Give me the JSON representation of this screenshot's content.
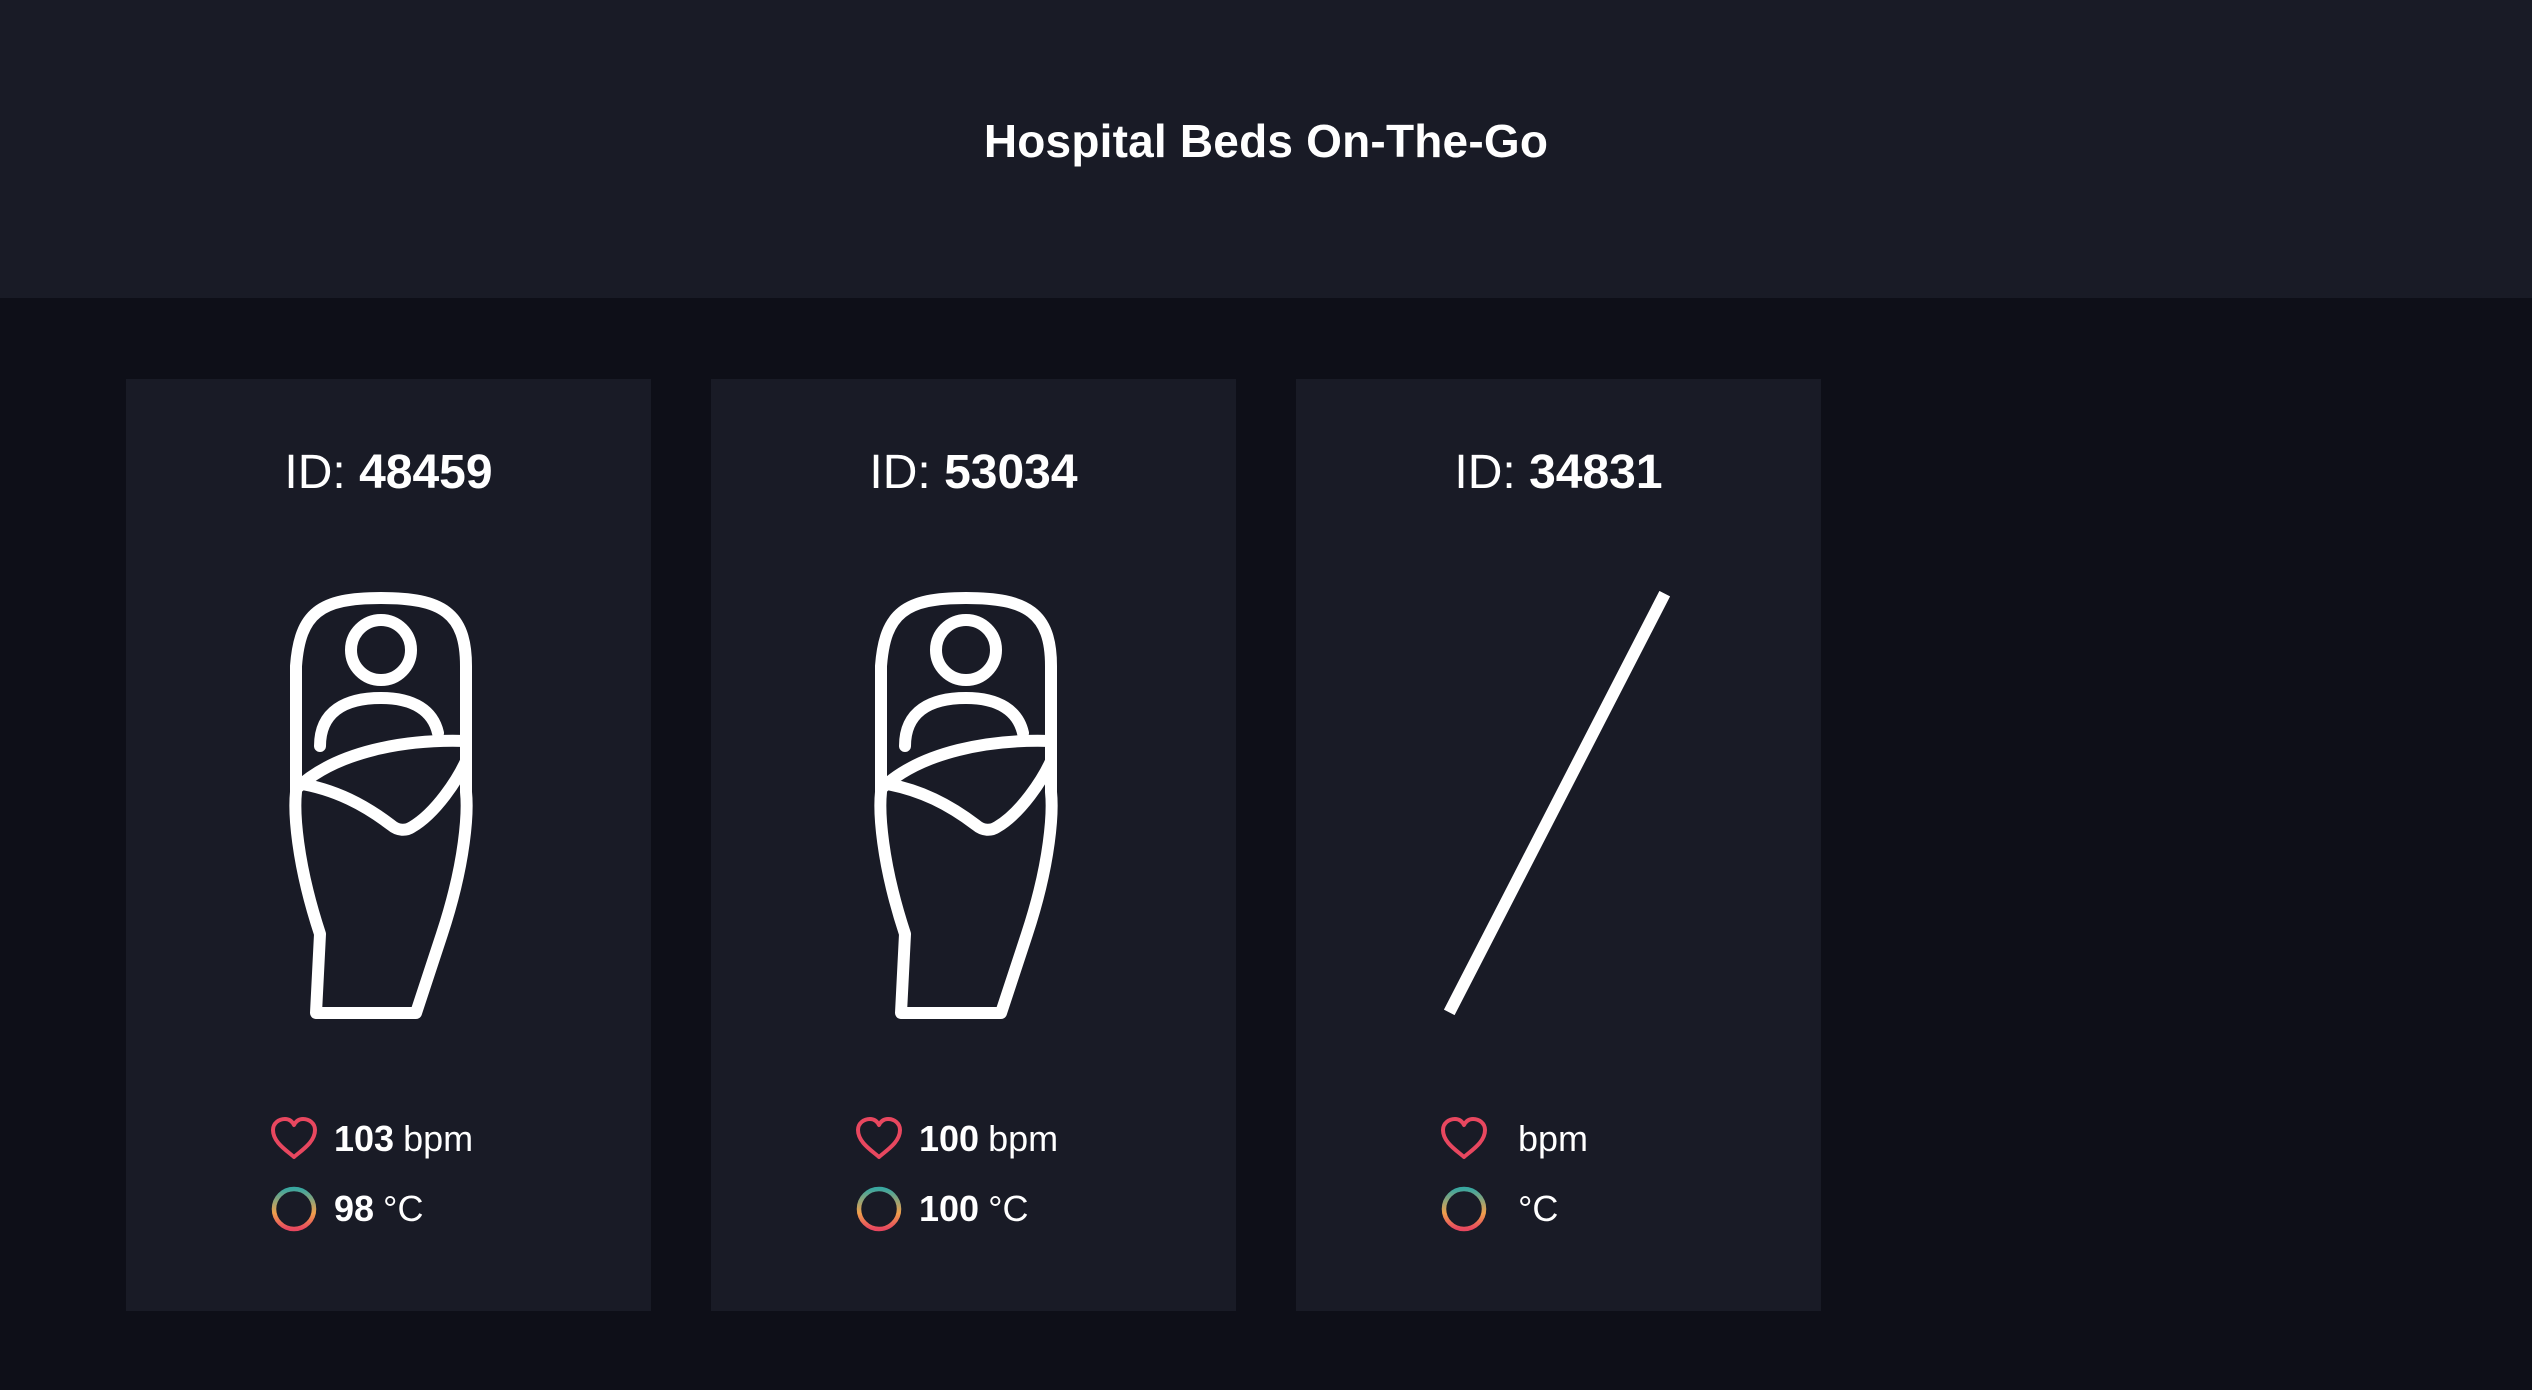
{
  "header": {
    "title": "Hospital Beds On-The-Go"
  },
  "colors": {
    "page_bg": "#0e0f18",
    "panel_bg": "#191b26",
    "heart": "#e8475f",
    "temp_ring": [
      "#3aa7a0",
      "#f08a4b",
      "#e8475f"
    ]
  },
  "cards": [
    {
      "id_label": "ID:",
      "id_value": "48459",
      "status": "occupied",
      "icon": "patient-in-bed-icon",
      "heart_rate": "103",
      "heart_unit": "bpm",
      "temperature": "98",
      "temp_unit": "°C"
    },
    {
      "id_label": "ID:",
      "id_value": "53034",
      "status": "occupied",
      "icon": "patient-in-bed-icon",
      "heart_rate": "100",
      "heart_unit": "bpm",
      "temperature": "100",
      "temp_unit": "°C"
    },
    {
      "id_label": "ID:",
      "id_value": "34831",
      "status": "empty",
      "icon": "empty-slash-icon",
      "heart_rate": "",
      "heart_unit": "bpm",
      "temperature": "",
      "temp_unit": "°C"
    }
  ]
}
